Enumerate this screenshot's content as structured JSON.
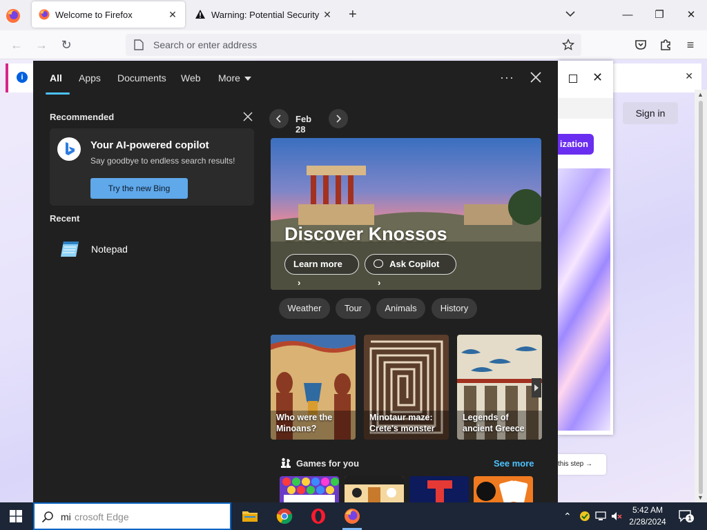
{
  "browser": {
    "tabs": [
      {
        "title": "Welcome to Firefox"
      },
      {
        "title": "Warning: Potential Security Risk Ahead"
      }
    ],
    "url_placeholder": "Search or enter address"
  },
  "page": {
    "sign_in": "Sign in",
    "purple_button": "ization",
    "last_step": "this step →"
  },
  "search_panel": {
    "tabs": [
      "All",
      "Apps",
      "Documents",
      "Web",
      "More"
    ],
    "recommended": {
      "heading": "Recommended",
      "title": "Your AI-powered copilot",
      "subtitle": "Say goodbye to endless search results!",
      "button": "Try the new Bing"
    },
    "recent": {
      "heading": "Recent",
      "items": [
        {
          "label": "Notepad",
          "icon": "notepad-icon"
        }
      ]
    },
    "date": "Feb 28",
    "hero": {
      "title": "Discover Knossos",
      "learn_more": "Learn more",
      "ask_copilot": "Ask Copilot"
    },
    "chips": [
      "Weather",
      "Tour",
      "Animals",
      "History"
    ],
    "cards": [
      {
        "line1": "Who were the",
        "line2": "Minoans?"
      },
      {
        "line1": "Minotaur maze:",
        "line2": "Crete's monster"
      },
      {
        "line1": "Legends of",
        "line2": "ancient Greece"
      }
    ],
    "games": {
      "heading": "Games for you",
      "see_more": "See more"
    }
  },
  "taskbar": {
    "search_typed": "mi",
    "search_suggestion": "crosoft Edge",
    "time": "5:42 AM",
    "date": "2/28/2024",
    "notification_count": "1"
  },
  "colors": {
    "panel_bg": "#202020",
    "accent": "#4cc2ff",
    "bing_button": "#5fa8ea",
    "taskbar": "#1c2636"
  }
}
